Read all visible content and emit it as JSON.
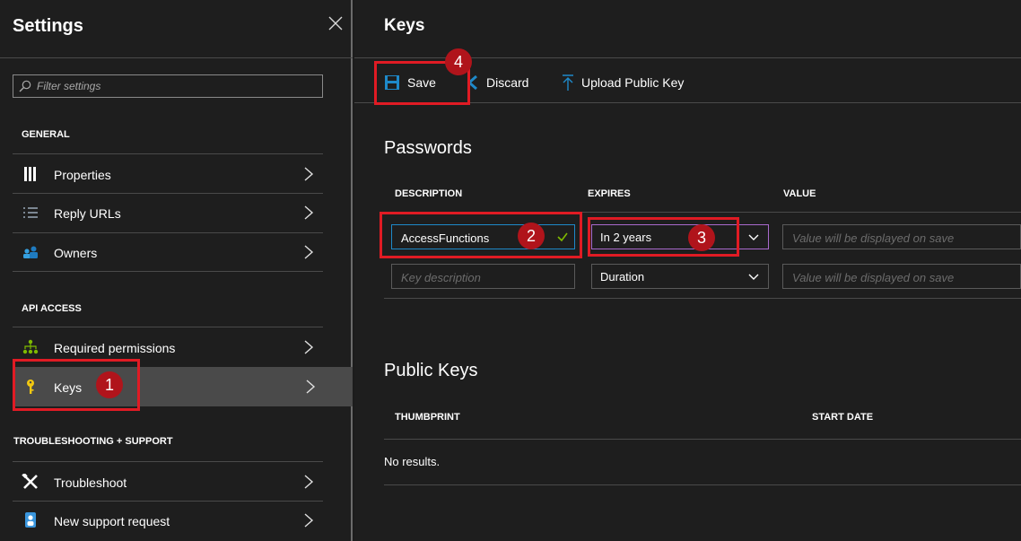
{
  "settings_panel": {
    "title": "Settings",
    "filter_placeholder": "Filter settings",
    "sections": {
      "general": "GENERAL",
      "api_access": "API ACCESS",
      "troubleshooting": "TROUBLESHOOTING + SUPPORT"
    },
    "items": {
      "properties": "Properties",
      "reply_urls": "Reply URLs",
      "owners": "Owners",
      "required_permissions": "Required permissions",
      "keys": "Keys",
      "troubleshoot": "Troubleshoot",
      "new_support_request": "New support request"
    },
    "active_item": "keys"
  },
  "keys_panel": {
    "title": "Keys",
    "toolbar": {
      "save": "Save",
      "discard": "Discard",
      "upload_public_key": "Upload Public Key"
    },
    "passwords": {
      "heading": "Passwords",
      "columns": [
        "DESCRIPTION",
        "EXPIRES",
        "VALUE"
      ],
      "rows": [
        {
          "description_value": "AccessFunctions",
          "expires_selected": "In 2 years",
          "value_placeholder": "Value will be displayed on save"
        },
        {
          "description_placeholder": "Key description",
          "expires_selected": "Duration",
          "value_placeholder": "Value will be displayed on save"
        }
      ]
    },
    "public_keys": {
      "heading": "Public Keys",
      "columns": [
        "THUMBPRINT",
        "START DATE"
      ],
      "empty_text": "No results."
    }
  },
  "callouts": [
    "1",
    "2",
    "3",
    "4"
  ],
  "colors": {
    "panel_bg": "#1e1e1e",
    "active_nav_bg": "#4a4a4a",
    "accent_blue": "#1e89c9",
    "callout_red": "#e01b24",
    "callout_badge": "#b0141b",
    "select_focus": "#a96acd"
  },
  "icons": {
    "properties": "properties-bars-icon",
    "reply_urls": "list-icon",
    "owners": "people-icon",
    "required_permissions": "hierarchy-icon",
    "keys": "key-icon",
    "troubleshoot": "tools-icon",
    "new_support_request": "person-support-icon",
    "save": "floppy-disk-icon",
    "discard": "discard-icon",
    "upload": "upload-arrow-icon"
  }
}
